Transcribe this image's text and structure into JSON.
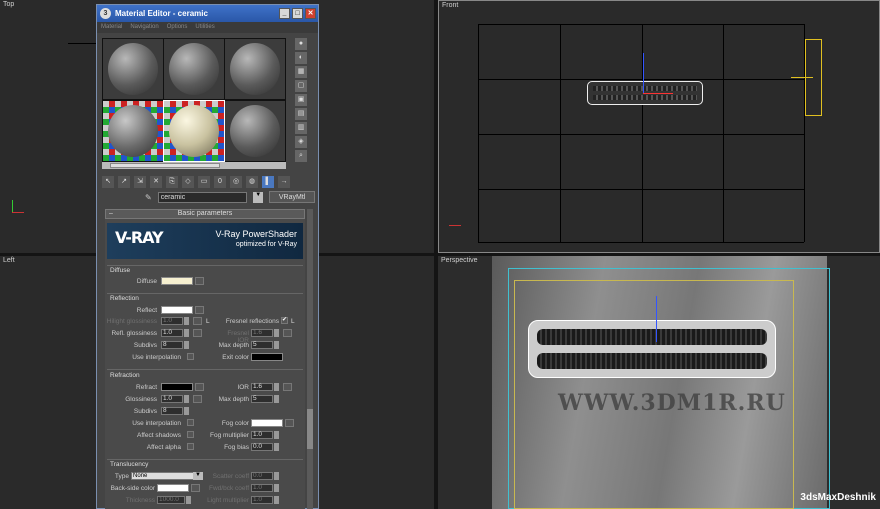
{
  "viewports": {
    "top": "Top",
    "front": "Front",
    "left": "Left",
    "perspective": "Perspective"
  },
  "window": {
    "title": "Material Editor - ceramic",
    "menu": [
      "Material",
      "Navigation",
      "Options",
      "Utilities"
    ]
  },
  "material": {
    "name": "ceramic",
    "type": "VRayMtl"
  },
  "rollout": {
    "title": "Basic parameters",
    "minus": "–"
  },
  "banner": {
    "logo": "V-RAY",
    "title": "V-Ray PowerShader",
    "subtitle": "optimized for V-Ray"
  },
  "diffuse": {
    "group": "Diffuse",
    "label": "Diffuse",
    "color": "#f6f0d0"
  },
  "reflection": {
    "group": "Reflection",
    "reflect_label": "Reflect",
    "reflect_color": "#ffffff",
    "hilight_label": "Hilight glossiness",
    "hilight_value": "1.0",
    "l1": "L",
    "refl_gloss_label": "Refl. glossiness",
    "refl_gloss_value": "1.0",
    "subdivs_label": "Subdivs",
    "subdivs_value": "8",
    "interp_label": "Use interpolation",
    "fresnel_label": "Fresnel reflections",
    "fresnel_check": "✔",
    "l2": "L",
    "fresnel_ior_label": "Fresnel IOR",
    "fresnel_ior_value": "1.6",
    "max_depth_label": "Max depth",
    "max_depth_value": "5",
    "exit_color_label": "Exit color",
    "exit_color": "#000000"
  },
  "refraction": {
    "group": "Refraction",
    "refract_label": "Refract",
    "refract_color": "#000000",
    "ior_label": "IOR",
    "ior_value": "1.6",
    "gloss_label": "Glossiness",
    "gloss_value": "1.0",
    "max_depth_label": "Max depth",
    "max_depth_value": "5",
    "subdivs_label": "Subdivs",
    "subdivs_value": "8",
    "interp_label": "Use interpolation",
    "fog_color_label": "Fog color",
    "fog_color": "#ffffff",
    "affect_shadows_label": "Affect shadows",
    "fog_mult_label": "Fog multiplier",
    "fog_mult_value": "1.0",
    "affect_alpha_label": "Affect alpha",
    "fog_bias_label": "Fog bias",
    "fog_bias_value": "0.0"
  },
  "translucency": {
    "group": "Translucency",
    "type_label": "Type",
    "type_value": "None",
    "scatter_label": "Scatter coeff",
    "scatter_value": "0.0",
    "backside_label": "Back-side color",
    "backside_color": "#ffffff",
    "fwdbck_label": "Fwd/bck coeff",
    "fwdbck_value": "1.0",
    "thickness_label": "Thickness",
    "thickness_value": "1000.0",
    "light_mult_label": "Light multiplier",
    "light_mult_value": "1.0"
  },
  "scene": {
    "watermark": "WWW.3DM1R.RU",
    "credit": "3dsMaxDeshnik"
  },
  "colors": {
    "titlebar": "#2a57a8",
    "front_border": "#888888",
    "light_yellow": "#e0c020",
    "frame_cyan": "#40c0d0"
  }
}
